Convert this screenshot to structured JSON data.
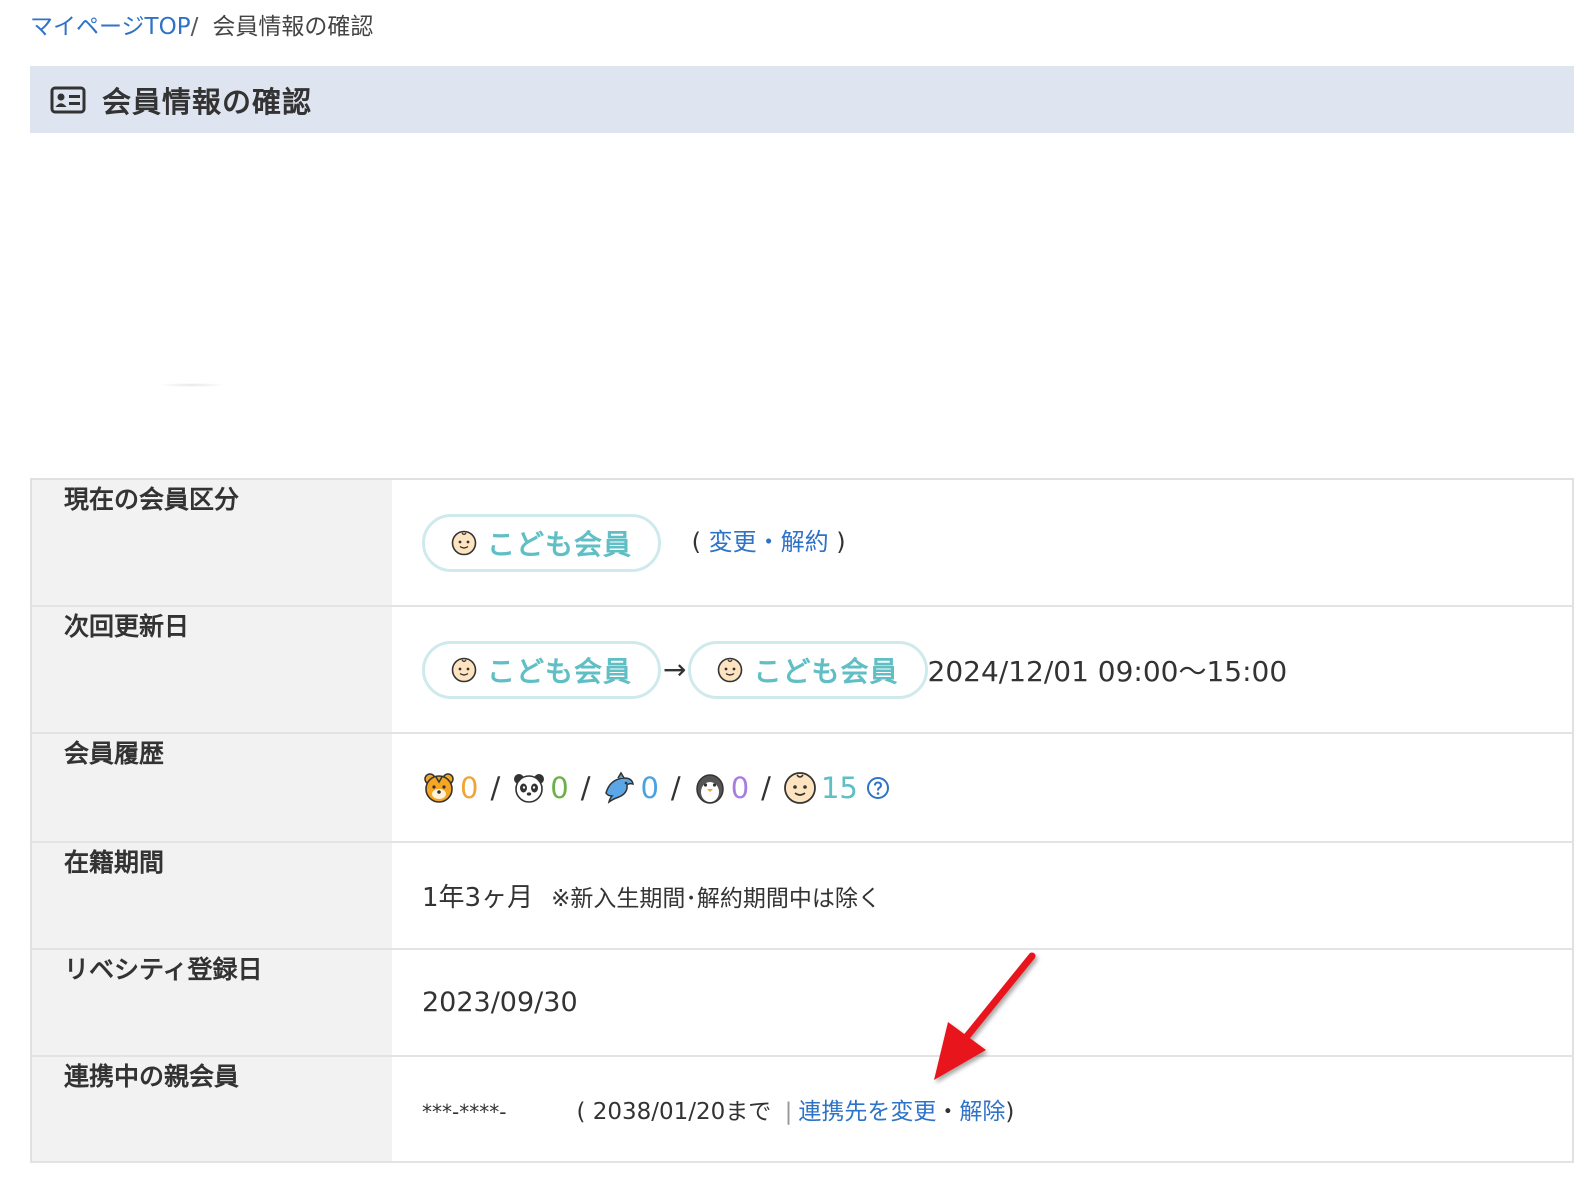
{
  "breadcrumb": {
    "top_link": "マイページTOP",
    "separator": "/",
    "current": "会員情報の確認"
  },
  "header": {
    "title": "会員情報の確認",
    "icon": "id-card-icon"
  },
  "rows": {
    "membership": {
      "label": "現在の会員区分",
      "badge": "こども会員",
      "badge_icon": "baby-face-icon",
      "paren_open": "(",
      "change_link": "変更",
      "dot": "・",
      "cancel_link": "解約",
      "paren_close": ")"
    },
    "renewal": {
      "label": "次回更新日",
      "from_badge": "こども会員",
      "arrow": "→",
      "to_badge": "こども会員",
      "datetime": "2024/12/01 09:00〜15:00"
    },
    "history": {
      "label": "会員履歴",
      "items": [
        {
          "icon": "tiger-icon",
          "count": "0"
        },
        {
          "icon": "panda-icon",
          "count": "0"
        },
        {
          "icon": "dolphin-icon",
          "count": "0"
        },
        {
          "icon": "penguin-icon",
          "count": "0"
        },
        {
          "icon": "baby-face-icon",
          "count": "15"
        }
      ],
      "separator": "/",
      "help_icon": "question-circle-icon"
    },
    "period": {
      "label": "在籍期間",
      "value": "1年3ヶ月",
      "note": "※新入生期間･解約期間中は除く"
    },
    "registered": {
      "label": "リベシティ登録日",
      "value": "2023/09/30"
    },
    "parent": {
      "label": "連携中の親会員",
      "masked_id": "***-****-",
      "until": "( 2038/01/20まで",
      "bar": "|",
      "change_link": "連携先を変更",
      "dot": "・",
      "release_link": "解除",
      "paren_close": ")"
    }
  },
  "colors": {
    "link": "#2f73c8",
    "header_bg": "#dfe5f0",
    "badge_text": "#5fbfc4",
    "badge_border": "#cfeaec",
    "annotation_arrow": "#e8191e"
  }
}
